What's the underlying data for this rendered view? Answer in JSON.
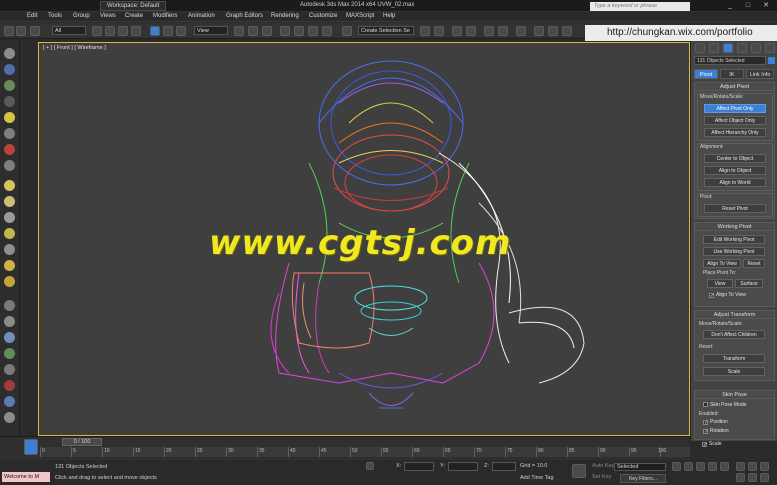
{
  "title_bar": {
    "workspace": "Workspace: Default",
    "app_title": "Autodesk 3ds Max  2014 x64      UVW_02.max",
    "search_placeholder": "Type a keyword or phrase",
    "minimize": "_",
    "maximize": "□",
    "close": "✕"
  },
  "menu": [
    "Edit",
    "Tools",
    "Group",
    "Views",
    "Create",
    "Modifiers",
    "Animation",
    "Graph Editors",
    "Rendering",
    "Customize",
    "MAXScript",
    "Help"
  ],
  "toolbar": {
    "filter": "All",
    "view_dropdown": "View",
    "create_selection_set": "Create Selection Se"
  },
  "portfolio_url": "http://chungkan.wix.com/portfolio",
  "viewport": {
    "label": "[ + ] [ Front ] [ Wireframe ]",
    "watermark": "www.cgtsj.com"
  },
  "command_panel": {
    "selection_field": "131 Objects Selected",
    "tabs": [
      "Pivot",
      "IK",
      "Link Info"
    ],
    "adjust_pivot": {
      "header": "Adjust Pivot",
      "move_label": "Move/Rotate/Scale:",
      "affect_pivot_only": "Affect Pivot Only",
      "affect_object_only": "Affect Object Only",
      "affect_hierarchy_only": "Affect Hierarchy Only",
      "alignment_label": "Alignment:",
      "center_to_object": "Center to Object",
      "align_to_object": "Align to Object",
      "align_to_world": "Align to World",
      "pivot_label": "Pivot:",
      "reset_pivot": "Reset Pivot"
    },
    "working_pivot": {
      "header": "Working Pivot",
      "edit_working_pivot": "Edit Working Pivot",
      "use_working_pivot": "Use Working Pivot",
      "align_to_view": "Align To View",
      "reset": "Reset",
      "place_pivot_to": "Place Pivot To:",
      "view": "View",
      "surface": "Surface",
      "align_to_view_check": "Align To View"
    },
    "adjust_transform": {
      "header": "Adjust Transform",
      "move_label": "Move/Rotate/Scale:",
      "dont_affect_children": "Don't Affect Children",
      "reset_label": "Reset:",
      "transform": "Transform",
      "scale": "Scale"
    },
    "skin_pose": {
      "header": "Skin Pose",
      "skin_pose_mode": "Skin Pose Mode",
      "enabled_label": "Enabled:",
      "position": "Position",
      "rotation": "Rotation",
      "scale": "Scale"
    }
  },
  "timeline": {
    "frame_counter": "0 / 100",
    "ticks": [
      "0",
      "5",
      "10",
      "15",
      "20",
      "25",
      "30",
      "35",
      "40",
      "45",
      "50",
      "55",
      "60",
      "65",
      "70",
      "75",
      "80",
      "85",
      "90",
      "95",
      "100"
    ]
  },
  "status": {
    "welcome": "Welcome to M",
    "objects_selected": "131 Objects Selected",
    "prompt": "Click and drag to select and move objects",
    "x_label": "X:",
    "y_label": "Y:",
    "z_label": "Z:",
    "grid": "Grid = 10.0",
    "add_time_tag": "Add Time Tag",
    "auto_key": "Auto Key",
    "set_key": "Set Key",
    "selected_dropdown": "Selected",
    "key_filters": "Key Filters..."
  }
}
